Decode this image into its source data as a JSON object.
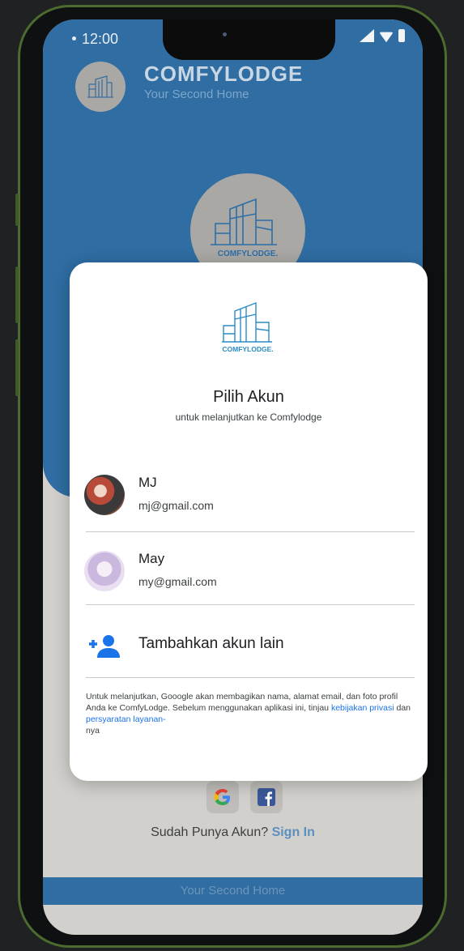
{
  "status_bar": {
    "time": "12:00"
  },
  "header": {
    "title": "COMFYLODGE",
    "subtitle": "Your Second Home"
  },
  "logo": {
    "text": "COMFYLODGE."
  },
  "dialog": {
    "title": "Pilih Akun",
    "subtitle": "untuk melanjutkan ke Comfylodge",
    "accounts": [
      {
        "name": "MJ",
        "email": "mj@gmail.com"
      },
      {
        "name": "May",
        "email": "my@gmail.com"
      }
    ],
    "add_account_label": "Tambahkan akun lain",
    "disclaimer": {
      "text": "Untuk melanjutkan, Gooogle akan membagikan nama, alamat email, dan foto profil Anda ke ComfyLodge. Sebelum menggunakan aplikasi ini, tinjau ",
      "privacy_link": "kebijakan privasi",
      "and": " dan ",
      "terms_link": "persyaratan layanan-",
      "suffix": "nya"
    }
  },
  "auth": {
    "question": "Sudah Punya Akun? ",
    "sign_in": "Sign In"
  },
  "footer": {
    "text": "Your Second Home"
  },
  "colors": {
    "primary_blue": "#2f6da3",
    "link_blue": "#1a73e8",
    "logo_blue": "#2b8bc6"
  }
}
